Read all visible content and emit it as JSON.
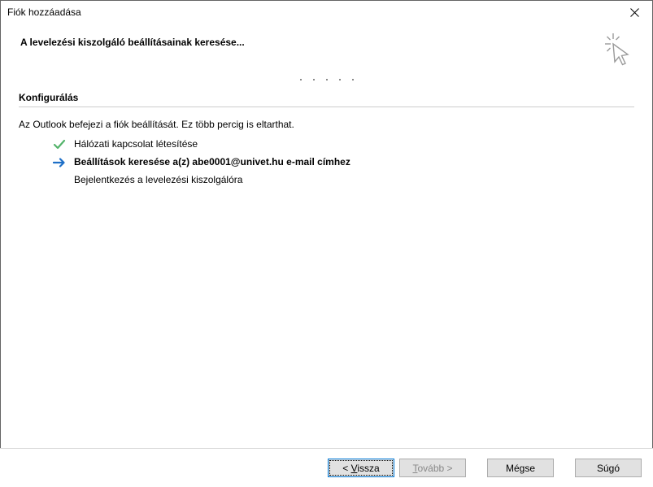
{
  "titlebar": {
    "title": "Fiók hozzáadása"
  },
  "header": {
    "title": "A levelezési kiszolgáló beállításainak keresése..."
  },
  "section": {
    "title": "Konfigurálás",
    "info": "Az Outlook befejezi a fiók beállítását. Ez több percig is eltarthat."
  },
  "steps": {
    "step1": "Hálózati kapcsolat létesítése",
    "step2": "Beállítások keresése a(z) abe0001@univet.hu e-mail címhez",
    "step3": "Bejelentkezés a levelezési kiszolgálóra"
  },
  "buttons": {
    "back_prefix": "< ",
    "back_letter": "V",
    "back_rest": "issza",
    "next_letter": "T",
    "next_rest": "ovább >",
    "cancel": "Mégse",
    "help": "Súgó"
  }
}
